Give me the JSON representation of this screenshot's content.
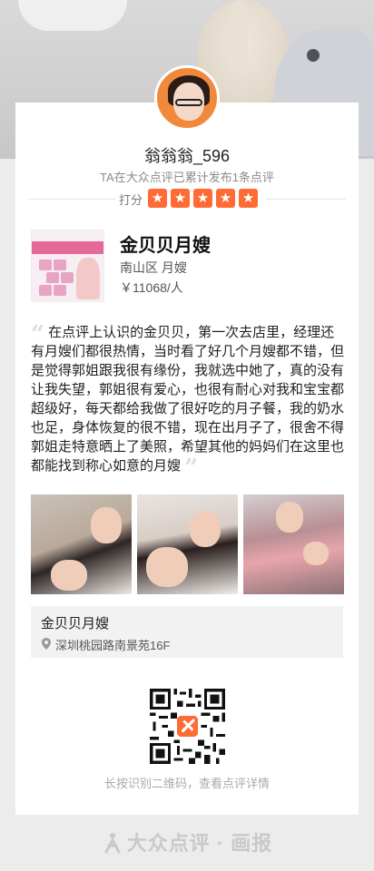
{
  "profile": {
    "username": "翁翁翁_596",
    "summary": "TA在大众点评已累计发布1条点评",
    "rating_label": "打分",
    "stars": 5
  },
  "shop": {
    "name": "金贝贝月嫂",
    "district_category": "南山区 月嫂",
    "price": "￥11068/人"
  },
  "review": {
    "text": "在点评上认识的金贝贝，第一次去店里，经理还有月嫂们都很热情，当时看了好几个月嫂都不错，但是觉得郭姐跟我很有缘份，我就选中她了，真的没有让我失望，郭姐很有爱心，也很有耐心对我和宝宝都超级好，每天都给我做了很好吃的月子餐，我的奶水也足，身体恢复的很不错，现在出月子了，很舍不得郭姐走特意晒上了美照，希望其他的妈妈们在这里也都能找到称心如意的月嫂",
    "open_quote": "“",
    "close_quote": "”"
  },
  "address": {
    "name": "金贝贝月嫂",
    "street": "深圳桃园路南景苑16F"
  },
  "qr_caption": "长按识别二维码，查看点评详情",
  "brand": "大众点评 · 画报",
  "colors": {
    "accent": "#ff6b35",
    "background": "#ececec"
  },
  "icons": {
    "star": "star-icon",
    "pin": "location-pin-icon",
    "logo": "dianping-logo-icon"
  }
}
